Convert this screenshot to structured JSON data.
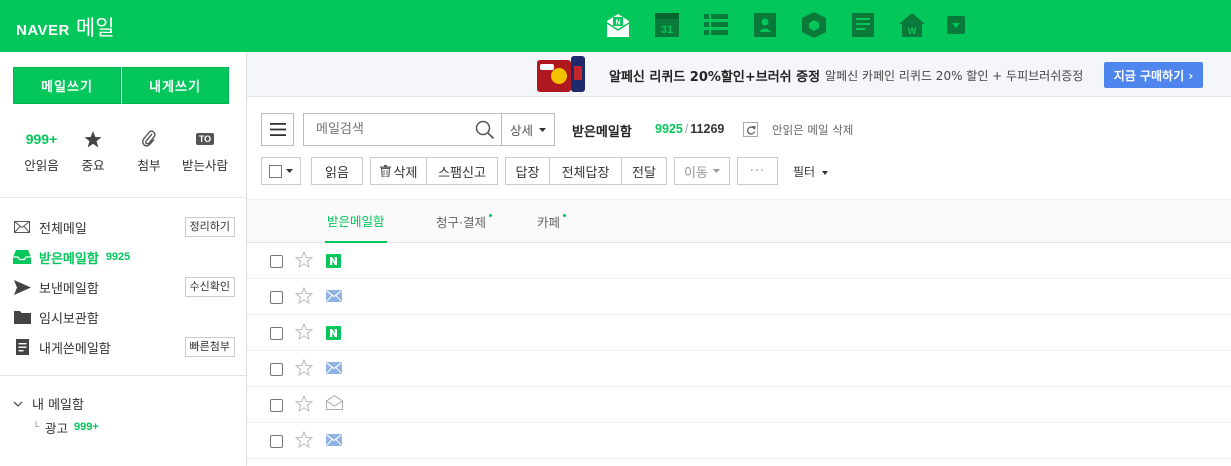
{
  "header": {
    "logo_brand": "NAVER",
    "logo_service": "메일",
    "apps": [
      {
        "icon": "mail-app-icon"
      },
      {
        "icon": "calendar-app-icon",
        "text": "31"
      },
      {
        "icon": "list-app-icon"
      },
      {
        "icon": "contacts-app-icon"
      },
      {
        "icon": "box-app-icon"
      },
      {
        "icon": "memo-app-icon"
      },
      {
        "icon": "home-app-icon"
      },
      {
        "icon": "more-apps-icon"
      }
    ]
  },
  "sidebar": {
    "write_mail": "메일쓰기",
    "write_self": "내게쓰기",
    "quick": {
      "unread_count": "999+",
      "unread_label": "안읽음",
      "important_label": "중요",
      "attach_label": "첨부",
      "to_badge": "TO",
      "recipient_label": "받는사람"
    },
    "folders": {
      "all": {
        "label": "전체메일",
        "btn": "정리하기"
      },
      "inbox": {
        "label": "받은메일함",
        "count": "9925"
      },
      "sent": {
        "label": "보낸메일함",
        "btn": "수신확인"
      },
      "drafts": {
        "label": "임시보관함"
      },
      "self": {
        "label": "내게쓴메일함",
        "btn": "빠른첨부"
      }
    },
    "mybox": {
      "title": "내 메일함",
      "sub_label": "광고",
      "sub_count": "999+"
    }
  },
  "banner": {
    "title": "알페신 리퀴드 20%할인+브러쉬 증정",
    "desc": "알페신 카페인 리퀴드 20% 할인 + 두피브러쉬증정",
    "cta": "지금 구매하기 ›"
  },
  "toolbar": {
    "search_placeholder": "메일검색",
    "detail": "상세",
    "box_title": "받은메일함",
    "unread": "9925",
    "total": "11269",
    "delete_unread": "안읽은 메일 삭제",
    "read": "읽음",
    "delete": "삭제",
    "spam": "스팸신고",
    "reply": "답장",
    "reply_all": "전체답장",
    "forward": "전달",
    "move": "이동",
    "more": "···",
    "filter": "필터"
  },
  "tabs": [
    {
      "label": "받은메일함"
    },
    {
      "label": "청구·결제"
    },
    {
      "label": "카페"
    }
  ],
  "rows": [
    {
      "icon": "naver-icon"
    },
    {
      "icon": "mail-icon"
    },
    {
      "icon": "naver-icon"
    },
    {
      "icon": "mail-icon"
    },
    {
      "icon": "open-mail-icon"
    },
    {
      "icon": "mail-icon"
    }
  ],
  "colors": {
    "brand": "#03c75a",
    "cta": "#4f86ed"
  }
}
